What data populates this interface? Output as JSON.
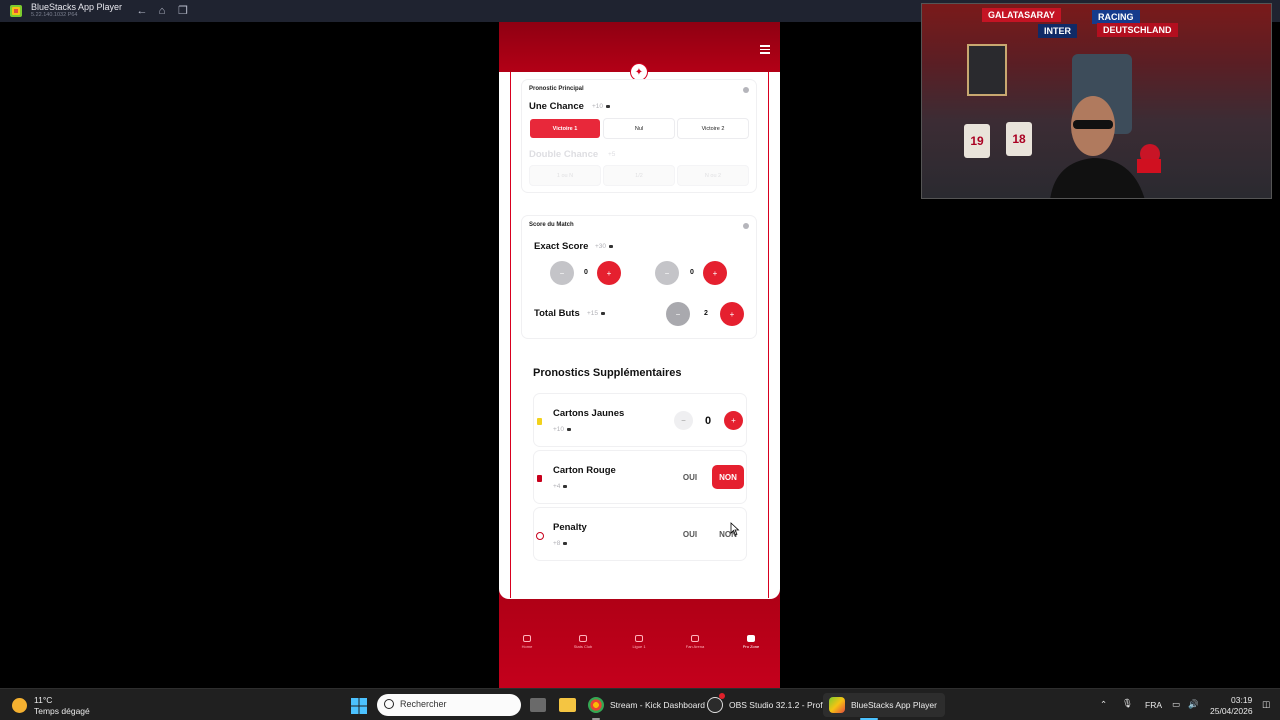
{
  "host_window": {
    "title": "BlueStacks App Player",
    "version": "5.22.140.1032  P64"
  },
  "app": {
    "menu_icon": "hamburger-icon",
    "main_prediction": {
      "section_label": "Pronostic Principal",
      "one_chance": {
        "label": "Une Chance",
        "points": "+10"
      },
      "options": [
        "Victoire 1",
        "Nul",
        "Victoire 2"
      ],
      "selected": "Victoire 1",
      "double_chance": {
        "label": "Double Chance",
        "points": "+5"
      },
      "double_options": [
        "1 ou N",
        "1/2",
        "N ou 2"
      ]
    },
    "match_score": {
      "section_label": "Score du Match",
      "exact_score": {
        "label": "Exact Score",
        "points": "+30",
        "home": "0",
        "away": "0"
      },
      "total_goals": {
        "label": "Total Buts",
        "points": "+15",
        "value": "2"
      }
    },
    "extras": {
      "title": "Pronostics Supplémentaires",
      "yellow_cards": {
        "label": "Cartons Jaunes",
        "points": "+10",
        "value": "0"
      },
      "red_card": {
        "label": "Carton Rouge",
        "points": "+4",
        "yes": "OUI",
        "no": "NON",
        "selected": "NON"
      },
      "penalty": {
        "label": "Penalty",
        "points": "+8",
        "yes": "OUI",
        "no": "NON"
      }
    },
    "nav": [
      {
        "label": "Home"
      },
      {
        "label": "Stats Club"
      },
      {
        "label": "Ligue 1"
      },
      {
        "label": "Fan Arena"
      },
      {
        "label": "Pro Zone"
      }
    ],
    "colors": {
      "brand_red": "#d50020",
      "accent_red": "#e5202f"
    }
  },
  "taskbar": {
    "weather_temp": "11°C",
    "weather_desc": "Temps dégagé",
    "search_placeholder": "Rechercher",
    "apps": [
      {
        "label": "Stream - Kick Dashboard"
      },
      {
        "label": "OBS Studio 32.1.2 - Prof"
      },
      {
        "label": "BlueStacks App Player"
      }
    ],
    "language": "FRA",
    "time": "03:19",
    "date": "25/04/2026"
  },
  "webcam": {
    "banners": [
      "GALATASARAY",
      "RACING",
      "DEUTSCHLAND",
      "INTER"
    ],
    "shirts": [
      "19",
      "18"
    ]
  }
}
